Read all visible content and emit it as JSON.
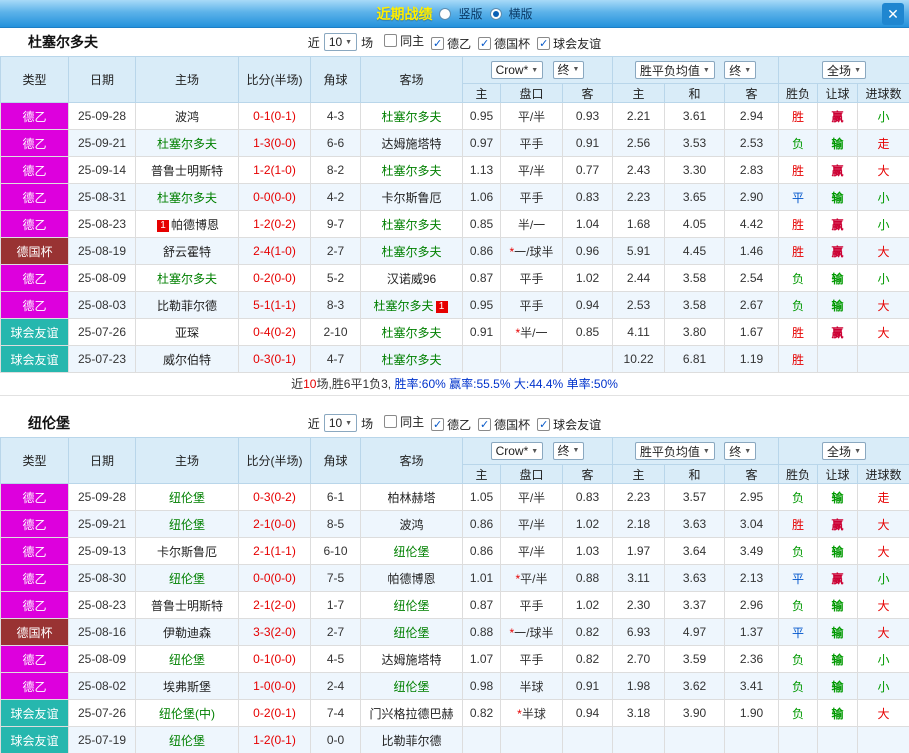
{
  "header": {
    "title": "近期战绩",
    "radio_vertical": "竖版",
    "radio_horizontal": "横版",
    "close_label": "✕"
  },
  "controls": {
    "near_label": "近",
    "match_count": "10",
    "matches_suffix": "场",
    "checkboxes": [
      {
        "key": "same-home",
        "label": "同主",
        "checked": false
      },
      {
        "key": "league-de2",
        "label": "德乙",
        "checked": true
      },
      {
        "key": "german-cup",
        "label": "德国杯",
        "checked": true
      },
      {
        "key": "club-friendly",
        "label": "球会友谊",
        "checked": true
      }
    ]
  },
  "filter": {
    "company": "Crow*",
    "final": "终",
    "avg": "胜平负均值",
    "scope": "全场"
  },
  "columns": {
    "type": "类型",
    "date": "日期",
    "home": "主场",
    "score": "比分(半场)",
    "corner": "角球",
    "away": "客场",
    "asia_home": "主",
    "handicap": "盘口",
    "asia_away": "客",
    "eu_home": "主",
    "eu_draw": "和",
    "eu_away": "客",
    "result": "胜负",
    "handicap_result": "让球",
    "goals": "进球数"
  },
  "colors": {
    "league_de2": "#dd00dd",
    "league_cup": "#993333",
    "league_friendly": "#26b7ae",
    "win": "#e60000",
    "draw": "#0055cc",
    "lose": "#009900",
    "score": "#e60000",
    "focus_team": "#008000"
  },
  "sections": [
    {
      "team": "杜塞尔多夫",
      "rows": [
        {
          "type": "德乙",
          "date": "25-09-28",
          "home": "波鸿",
          "home_green": false,
          "score": "0-1(0-1)",
          "corner": "4-3",
          "away": "杜塞尔多夫",
          "away_green": true,
          "ah": "0.95",
          "hcap": "平/半",
          "aa": "0.93",
          "eh": "2.21",
          "ed": "3.61",
          "ea": "2.94",
          "res": "胜",
          "hr": "赢",
          "goal": "小"
        },
        {
          "type": "德乙",
          "date": "25-09-21",
          "home": "杜塞尔多夫",
          "home_green": true,
          "score": "1-3(0-0)",
          "corner": "6-6",
          "away": "达姆施塔特",
          "away_green": false,
          "ah": "0.97",
          "hcap": "平手",
          "aa": "0.91",
          "eh": "2.56",
          "ed": "3.53",
          "ea": "2.53",
          "res": "负",
          "hr": "输",
          "goal": "走"
        },
        {
          "type": "德乙",
          "date": "25-09-14",
          "home": "普鲁士明斯特",
          "home_green": false,
          "score": "1-2(1-0)",
          "corner": "8-2",
          "away": "杜塞尔多夫",
          "away_green": true,
          "ah": "1.13",
          "hcap": "平/半",
          "aa": "0.77",
          "eh": "2.43",
          "ed": "3.30",
          "ea": "2.83",
          "res": "胜",
          "hr": "赢",
          "goal": "大"
        },
        {
          "type": "德乙",
          "date": "25-08-31",
          "home": "杜塞尔多夫",
          "home_green": true,
          "score": "0-0(0-0)",
          "corner": "4-2",
          "away": "卡尔斯鲁厄",
          "away_green": false,
          "ah": "1.06",
          "hcap": "平手",
          "aa": "0.83",
          "eh": "2.23",
          "ed": "3.65",
          "ea": "2.90",
          "res": "平",
          "hr": "输",
          "goal": "小"
        },
        {
          "type": "德乙",
          "date": "25-08-23",
          "home": "帕德博恩",
          "home_green": false,
          "home_badge": "1",
          "home_badge_pos": "before",
          "score": "1-2(0-2)",
          "corner": "9-7",
          "away": "杜塞尔多夫",
          "away_green": true,
          "ah": "0.85",
          "hcap": "半/一",
          "aa": "1.04",
          "eh": "1.68",
          "ed": "4.05",
          "ea": "4.42",
          "res": "胜",
          "hr": "赢",
          "goal": "小"
        },
        {
          "type": "德国杯",
          "date": "25-08-19",
          "home": "舒云霍特",
          "home_green": false,
          "score": "2-4(1-0)",
          "corner": "2-7",
          "away": "杜塞尔多夫",
          "away_green": true,
          "ah": "0.86",
          "hcap": "*一/球半",
          "aa": "0.96",
          "eh": "5.91",
          "ed": "4.45",
          "ea": "1.46",
          "res": "胜",
          "hr": "赢",
          "goal": "大"
        },
        {
          "type": "德乙",
          "date": "25-08-09",
          "home": "杜塞尔多夫",
          "home_green": true,
          "score": "0-2(0-0)",
          "corner": "5-2",
          "away": "汉诺威96",
          "away_green": false,
          "ah": "0.87",
          "hcap": "平手",
          "aa": "1.02",
          "eh": "2.44",
          "ed": "3.58",
          "ea": "2.54",
          "res": "负",
          "hr": "输",
          "goal": "小"
        },
        {
          "type": "德乙",
          "date": "25-08-03",
          "home": "比勒菲尔德",
          "home_green": false,
          "score": "5-1(1-1)",
          "corner": "8-3",
          "away": "杜塞尔多夫",
          "away_green": true,
          "away_badge": "1",
          "away_badge_pos": "after",
          "ah": "0.95",
          "hcap": "平手",
          "aa": "0.94",
          "eh": "2.53",
          "ed": "3.58",
          "ea": "2.67",
          "res": "负",
          "hr": "输",
          "goal": "大"
        },
        {
          "type": "球会友谊",
          "date": "25-07-26",
          "home": "亚琛",
          "home_green": false,
          "score": "0-4(0-2)",
          "corner": "2-10",
          "away": "杜塞尔多夫",
          "away_green": true,
          "ah": "0.91",
          "hcap": "*半/一",
          "aa": "0.85",
          "eh": "4.11",
          "ed": "3.80",
          "ea": "1.67",
          "res": "胜",
          "hr": "赢",
          "goal": "大"
        },
        {
          "type": "球会友谊",
          "date": "25-07-23",
          "home": "威尔伯特",
          "home_green": false,
          "score": "0-3(0-1)",
          "corner": "4-7",
          "away": "杜塞尔多夫",
          "away_green": true,
          "ah": "",
          "hcap": "",
          "aa": "",
          "eh": "10.22",
          "ed": "6.81",
          "ea": "1.19",
          "res": "胜",
          "hr": "",
          "goal": ""
        }
      ],
      "summary": [
        {
          "text": "近",
          "color": "#333333"
        },
        {
          "text": "10",
          "color": "#e60000"
        },
        {
          "text": "场,胜6平1负3, ",
          "color": "#333333"
        },
        {
          "text": "胜率:60% ",
          "color": "#0033cc"
        },
        {
          "text": "赢率:55.5% ",
          "color": "#0033cc"
        },
        {
          "text": "大:44.4% ",
          "color": "#0033cc"
        },
        {
          "text": "单率:50%",
          "color": "#0033cc"
        }
      ]
    },
    {
      "team": "纽伦堡",
      "rows": [
        {
          "type": "德乙",
          "date": "25-09-28",
          "home": "纽伦堡",
          "home_green": true,
          "score": "0-3(0-2)",
          "corner": "6-1",
          "away": "柏林赫塔",
          "away_green": false,
          "ah": "1.05",
          "hcap": "平/半",
          "aa": "0.83",
          "eh": "2.23",
          "ed": "3.57",
          "ea": "2.95",
          "res": "负",
          "hr": "输",
          "goal": "走"
        },
        {
          "type": "德乙",
          "date": "25-09-21",
          "home": "纽伦堡",
          "home_green": true,
          "score": "2-1(0-0)",
          "corner": "8-5",
          "away": "波鸿",
          "away_green": false,
          "ah": "0.86",
          "hcap": "平/半",
          "aa": "1.02",
          "eh": "2.18",
          "ed": "3.63",
          "ea": "3.04",
          "res": "胜",
          "hr": "赢",
          "goal": "大"
        },
        {
          "type": "德乙",
          "date": "25-09-13",
          "home": "卡尔斯鲁厄",
          "home_green": false,
          "score": "2-1(1-1)",
          "corner": "6-10",
          "away": "纽伦堡",
          "away_green": true,
          "ah": "0.86",
          "hcap": "平/半",
          "aa": "1.03",
          "eh": "1.97",
          "ed": "3.64",
          "ea": "3.49",
          "res": "负",
          "hr": "输",
          "goal": "大"
        },
        {
          "type": "德乙",
          "date": "25-08-30",
          "home": "纽伦堡",
          "home_green": true,
          "score": "0-0(0-0)",
          "corner": "7-5",
          "away": "帕德博恩",
          "away_green": false,
          "ah": "1.01",
          "hcap": "*平/半",
          "aa": "0.88",
          "eh": "3.11",
          "ed": "3.63",
          "ea": "2.13",
          "res": "平",
          "hr": "赢",
          "goal": "小"
        },
        {
          "type": "德乙",
          "date": "25-08-23",
          "home": "普鲁士明斯特",
          "home_green": false,
          "score": "2-1(2-0)",
          "corner": "1-7",
          "away": "纽伦堡",
          "away_green": true,
          "ah": "0.87",
          "hcap": "平手",
          "aa": "1.02",
          "eh": "2.30",
          "ed": "3.37",
          "ea": "2.96",
          "res": "负",
          "hr": "输",
          "goal": "大"
        },
        {
          "type": "德国杯",
          "date": "25-08-16",
          "home": "伊勒迪森",
          "home_green": false,
          "score": "3-3(2-0)",
          "corner": "2-7",
          "away": "纽伦堡",
          "away_green": true,
          "ah": "0.88",
          "hcap": "*一/球半",
          "aa": "0.82",
          "eh": "6.93",
          "ed": "4.97",
          "ea": "1.37",
          "res": "平",
          "hr": "输",
          "goal": "大"
        },
        {
          "type": "德乙",
          "date": "25-08-09",
          "home": "纽伦堡",
          "home_green": true,
          "score": "0-1(0-0)",
          "corner": "4-5",
          "away": "达姆施塔特",
          "away_green": false,
          "ah": "1.07",
          "hcap": "平手",
          "aa": "0.82",
          "eh": "2.70",
          "ed": "3.59",
          "ea": "2.36",
          "res": "负",
          "hr": "输",
          "goal": "小"
        },
        {
          "type": "德乙",
          "date": "25-08-02",
          "home": "埃弗斯堡",
          "home_green": false,
          "score": "1-0(0-0)",
          "corner": "2-4",
          "away": "纽伦堡",
          "away_green": true,
          "ah": "0.98",
          "hcap": "半球",
          "aa": "0.91",
          "eh": "1.98",
          "ed": "3.62",
          "ea": "3.41",
          "res": "负",
          "hr": "输",
          "goal": "小"
        },
        {
          "type": "球会友谊",
          "date": "25-07-26",
          "home": "纽伦堡(中)",
          "home_green": true,
          "score": "0-2(0-1)",
          "corner": "7-4",
          "away": "门兴格拉德巴赫",
          "away_green": false,
          "ah": "0.82",
          "hcap": "*半球",
          "aa": "0.94",
          "eh": "3.18",
          "ed": "3.90",
          "ea": "1.90",
          "res": "负",
          "hr": "输",
          "goal": "大"
        },
        {
          "type": "球会友谊",
          "date": "25-07-19",
          "home": "纽伦堡",
          "home_green": true,
          "score": "1-2(0-1)",
          "corner": "0-0",
          "away": "比勒菲尔德",
          "away_green": false,
          "ah": "",
          "hcap": "",
          "aa": "",
          "eh": "",
          "ed": "",
          "ea": "",
          "res": "",
          "hr": "",
          "goal": ""
        }
      ],
      "summary": []
    }
  ]
}
